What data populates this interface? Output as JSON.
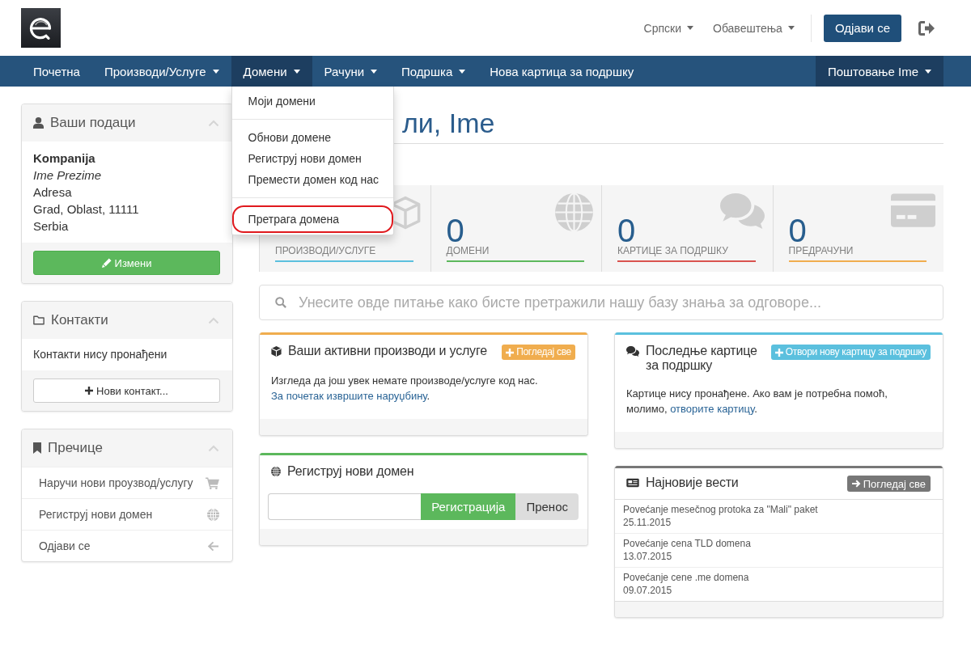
{
  "header": {
    "language": "Српски",
    "notifications": "Обавештења",
    "logout_button": "Одјави се"
  },
  "nav": {
    "items": [
      {
        "label": "Почетна",
        "dropdown": false,
        "selected": false
      },
      {
        "label": "Производи/Услуге",
        "dropdown": true,
        "selected": false
      },
      {
        "label": "Домени",
        "dropdown": true,
        "selected": true
      },
      {
        "label": "Рачуни",
        "dropdown": true,
        "selected": false
      },
      {
        "label": "Подршка",
        "dropdown": true,
        "selected": false
      },
      {
        "label": "Нова картица за подршку",
        "dropdown": false,
        "selected": false
      }
    ],
    "account": {
      "label": "Поштовање Ime",
      "dropdown": true
    },
    "open_menu": {
      "items": [
        {
          "kind": "link",
          "label": "Моји домени",
          "highlighted": false
        },
        {
          "kind": "divider"
        },
        {
          "kind": "link",
          "label": "Обнови домене",
          "highlighted": false
        },
        {
          "kind": "link",
          "label": "Региструј нови домен",
          "highlighted": false
        },
        {
          "kind": "link",
          "label": "Премести домен код нас",
          "highlighted": false
        },
        {
          "kind": "divider"
        },
        {
          "kind": "link",
          "label": "Претрага домена",
          "highlighted": true
        }
      ]
    }
  },
  "sidebar": {
    "panels": [
      {
        "kind": "details",
        "title": "Ваши подаци",
        "expanded": true,
        "lines": [
          {
            "text": "Kompanija",
            "kind": "company"
          },
          {
            "text": "Ime Prezime",
            "kind": "person"
          },
          {
            "text": "Adresa",
            "kind": "address"
          },
          {
            "text": "Grad, Oblast, 11111",
            "kind": "address"
          },
          {
            "text": "Serbia",
            "kind": "address"
          }
        ],
        "button": {
          "kind": "edit",
          "label": "Измени"
        }
      },
      {
        "kind": "contacts",
        "title": "Контакти",
        "expanded": true,
        "message": "Контакти нису пронађени",
        "button": {
          "kind": "add",
          "label": "Нови контакт..."
        }
      },
      {
        "kind": "shortcuts",
        "title": "Пречице",
        "expanded": true,
        "items": [
          {
            "kind": "order",
            "label": "Наручи нови проузвод/услугу"
          },
          {
            "kind": "domain",
            "label": "Региструј нови домен"
          },
          {
            "kind": "logout",
            "label": "Одјави се"
          }
        ]
      }
    ]
  },
  "page_title": "ли, Ime",
  "stats": [
    {
      "kind": "services",
      "label": "ПРОИЗВОДИ/УСЛУГЕ",
      "color": "#5bc0de"
    },
    {
      "kind": "domains",
      "value": "0",
      "label": "ДОМЕНИ",
      "color": "#5cb85c"
    },
    {
      "kind": "tickets",
      "value": "0",
      "label": "КАРТИЦЕ ЗА ПОДРШКУ",
      "color": "#d9534f"
    },
    {
      "kind": "invoices",
      "value": "0",
      "label": "ПРЕДРАЧУНИ",
      "color": "#f0ad4e"
    }
  ],
  "search": {
    "placeholder": "Унесите овде питање како бисте претражили нашу базу знања за одговоре..."
  },
  "panels": {
    "left": [
      {
        "kind": "services",
        "title": "Ваши активни производи и услуге",
        "color": "#f0ad4e",
        "button": {
          "kind": "add",
          "label": "Погледај све"
        },
        "message": {
          "text": "Изгледа да још увек немате производе/услуге код нас.",
          "link": "За почетак извршите наруџбину",
          "after": "."
        }
      },
      {
        "kind": "domain",
        "title": "Региструј нови домен",
        "color": "#5cb85c",
        "buttons": [
          {
            "kind": "register",
            "label": "Регистрација"
          },
          {
            "kind": "transfer",
            "label": "Пренос"
          }
        ]
      }
    ],
    "right": [
      {
        "kind": "tickets",
        "title": "Последње картице за подршку",
        "color": "#5bc0de",
        "button": {
          "kind": "add",
          "label": "Отвори нову картицу за подршку"
        },
        "message": {
          "text": "Картице нису пронађене. Ако вам је потребна помоћ, молимо,",
          "link": "отворите картицу",
          "after": "."
        }
      },
      {
        "kind": "news",
        "title": "Најновије вести",
        "color": "#777777",
        "button": {
          "kind": "go",
          "label": "Погледај све"
        },
        "items": [
          {
            "title": "Povećanje mesečnog protoka za \"Mali\" paket",
            "date": "25.11.2015"
          },
          {
            "title": "Povećanje cena TLD domena",
            "date": "13.07.2015"
          },
          {
            "title": "Povećanje cene .me domena",
            "date": "09.07.2015"
          }
        ]
      }
    ]
  }
}
